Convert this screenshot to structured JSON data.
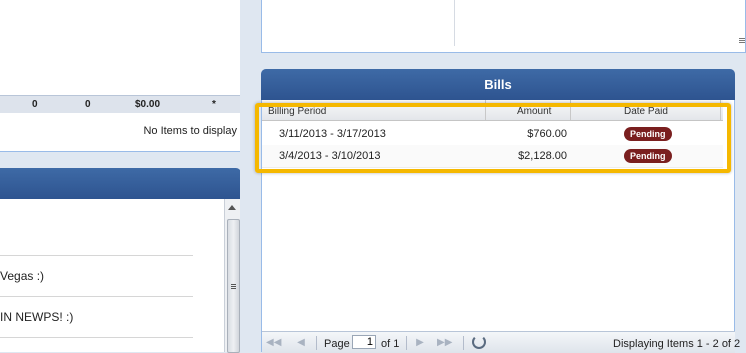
{
  "left": {
    "summary_row": [
      "0",
      "0",
      "$0.00",
      "*"
    ],
    "no_items_text": "No Items to display",
    "messages": [
      {
        "text": "Vegas :)"
      },
      {
        "text": "IN NEWPS! :)"
      }
    ]
  },
  "bills": {
    "title": "Bills",
    "columns": [
      "Billing Period",
      "Amount",
      "Date Paid"
    ],
    "rows": [
      {
        "period": "3/11/2013 - 3/17/2013",
        "amount": "$760.00",
        "status": "Pending"
      },
      {
        "period": "3/4/2013 - 3/10/2013",
        "amount": "$2,128.00",
        "status": "Pending"
      }
    ],
    "paging": {
      "page_label": "Page",
      "page_value": "1",
      "of_label": "of 1",
      "display_text": "Displaying Items 1 - 2 of 2"
    }
  },
  "colors": {
    "header_blue": "#2e5490",
    "highlight": "#f5b800",
    "badge": "#7a1f1f"
  },
  "icons": [
    "first-page-icon",
    "prev-page-icon",
    "next-page-icon",
    "last-page-icon",
    "refresh-icon",
    "scroll-up-icon",
    "scroll-down-icon",
    "grip-icon"
  ]
}
